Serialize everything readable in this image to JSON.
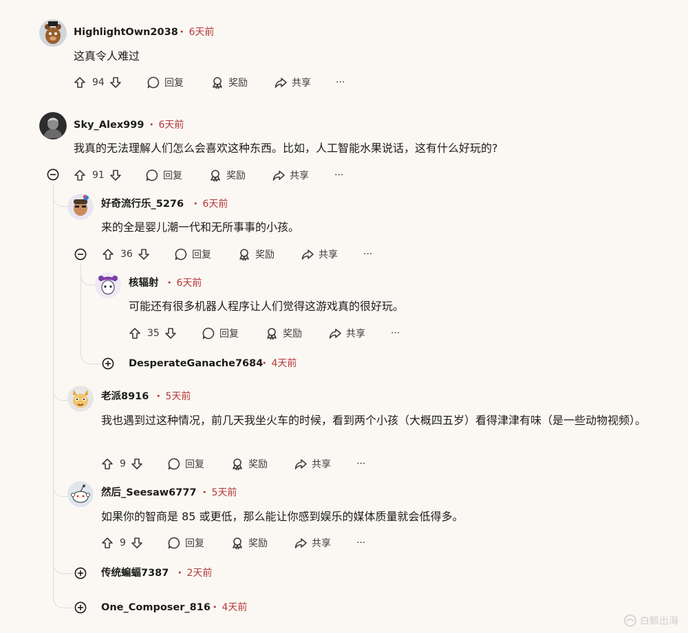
{
  "comments": [
    {
      "author": "HighlightOwn2038",
      "time": "6天前",
      "body": "这真令人难过",
      "votes": "94",
      "reply": "回复",
      "award": "奖励",
      "share": "共享"
    },
    {
      "author": "Sky_Alex999",
      "time": "6天前",
      "body": "我真的无法理解人们怎么会喜欢这种东西。比如，人工智能水果说话，这有什么好玩的?",
      "votes": "91",
      "reply": "回复",
      "award": "奖励",
      "share": "共享"
    },
    {
      "author": "好奇流行乐_5276",
      "time": "6天前",
      "body": "来的全是婴儿潮一代和无所事事的小孩。",
      "votes": "36",
      "reply": "回复",
      "award": "奖励",
      "share": "共享"
    },
    {
      "author": "核辐射",
      "time": "6天前",
      "body": "可能还有很多机器人程序让人们觉得这游戏真的很好玩。",
      "votes": "35",
      "reply": "回复",
      "award": "奖励",
      "share": "共享"
    },
    {
      "author": "DesperateGanache7684",
      "time": "4天前"
    },
    {
      "author": "老派8916",
      "time": "5天前",
      "body": "我也遇到过这种情况，前几天我坐火车的时候，看到两个小孩（大概四五岁）看得津津有味（是一些动物视频）。",
      "votes": "9",
      "reply": "回复",
      "award": "奖励",
      "share": "共享"
    },
    {
      "author": "然后_Seesaw6777",
      "time": "5天前",
      "body": "如果你的智商是 85 或更低，那么能让你感到娱乐的媒体质量就会低得多。",
      "votes": "9",
      "reply": "回复",
      "award": "奖励",
      "share": "共享"
    },
    {
      "author": "传统蝙蝠7387",
      "time": "2天前"
    },
    {
      "author": "One_Composer_816",
      "time": "4天前"
    }
  ],
  "more_label": "···",
  "watermark": "白鲸出海",
  "colors": {
    "background": "#fbf8f3",
    "time": "#b4373a",
    "thread_line": "#dcdcdc"
  }
}
